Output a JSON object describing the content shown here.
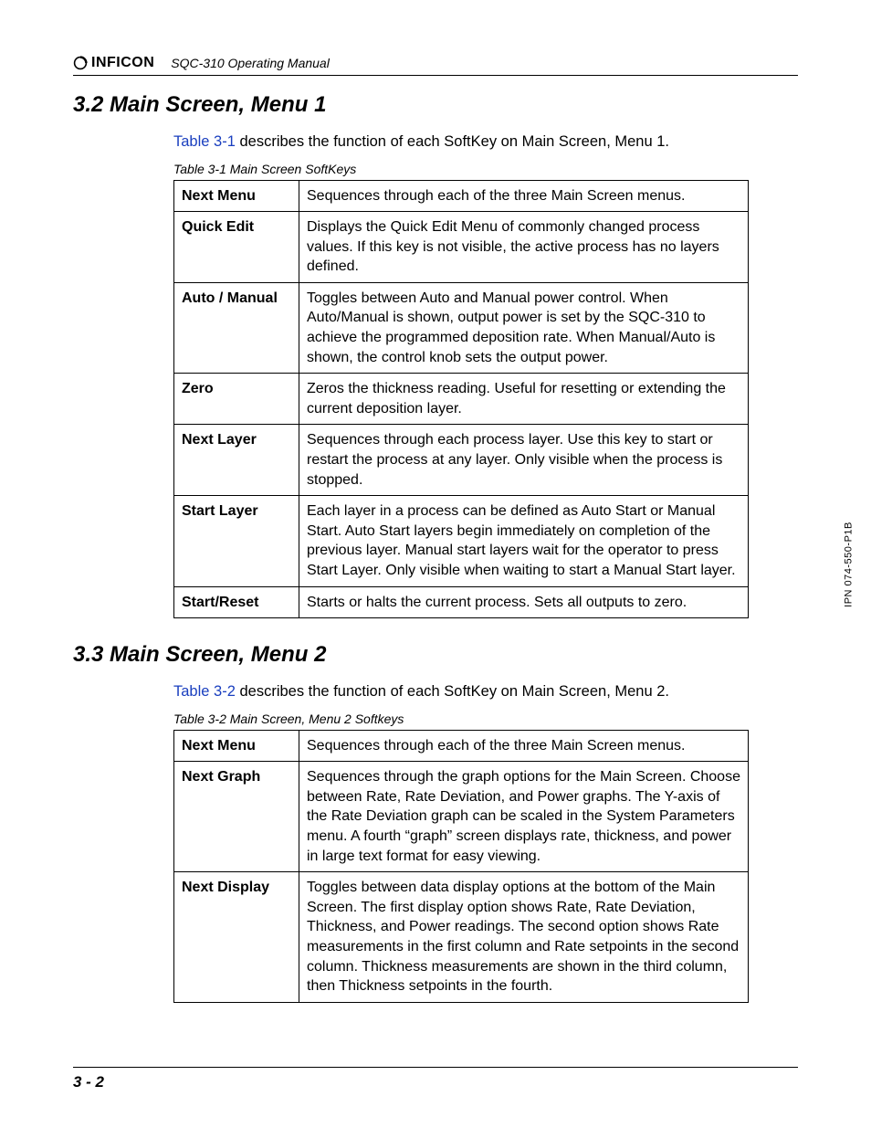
{
  "header": {
    "brand": "INFICON",
    "doc_title": "SQC-310 Operating Manual"
  },
  "side_label": "IPN 074-550-P1B",
  "page_number": "3 - 2",
  "sections": [
    {
      "heading": "3.2  Main Screen, Menu 1",
      "intro_link": "Table 3-1",
      "intro_rest": " describes the function of each SoftKey on Main Screen, Menu 1.",
      "caption": "Table 3-1  Main Screen SoftKeys",
      "rows": [
        {
          "key": "Next Menu",
          "desc": "Sequences through each of the three Main Screen menus."
        },
        {
          "key": "Quick Edit",
          "desc": "Displays the Quick Edit Menu of commonly changed process values. If this key is not visible, the active process has no layers defined."
        },
        {
          "key": "Auto / Manual",
          "desc": "Toggles between Auto and Manual power control. When Auto/Manual is shown, output power is set by the SQC-310 to achieve the programmed deposition rate. When Manual/Auto is shown, the control knob sets the output power."
        },
        {
          "key": "Zero",
          "desc": "Zeros the thickness reading. Useful for resetting or extending the current deposition layer."
        },
        {
          "key": "Next Layer",
          "desc": "Sequences through each process layer. Use this key to start or restart the process at any layer. Only visible when the process is stopped."
        },
        {
          "key": "Start Layer",
          "desc": "Each layer in a process can be defined as Auto Start or Manual Start. Auto Start layers begin immediately on completion of the previous layer. Manual start layers wait for the operator to press Start Layer. Only visible when waiting to start a Manual Start layer."
        },
        {
          "key": "Start/Reset",
          "desc": "Starts or halts the current process. Sets all outputs to zero."
        }
      ]
    },
    {
      "heading": "3.3  Main Screen, Menu 2",
      "intro_link": "Table 3-2",
      "intro_rest": " describes the function of each SoftKey on Main Screen, Menu 2.",
      "caption": "Table 3-2  Main Screen, Menu 2 Softkeys",
      "rows": [
        {
          "key": "Next Menu",
          "desc": "Sequences through each of the three Main Screen menus."
        },
        {
          "key": "Next Graph",
          "desc": "Sequences through the graph options for the Main Screen. Choose between Rate, Rate Deviation, and Power graphs. The Y-axis of the Rate Deviation graph can be scaled in the System Parameters menu. A fourth “graph” screen displays rate, thickness, and power in large text format for easy viewing."
        },
        {
          "key": "Next Display",
          "desc": "Toggles between data display options at the bottom of the Main Screen. The first display option shows Rate, Rate Deviation, Thickness, and Power readings. The second option shows Rate measurements in the first column and Rate setpoints in the second column. Thickness measurements are shown in the third column, then Thickness setpoints in the fourth."
        }
      ]
    }
  ]
}
